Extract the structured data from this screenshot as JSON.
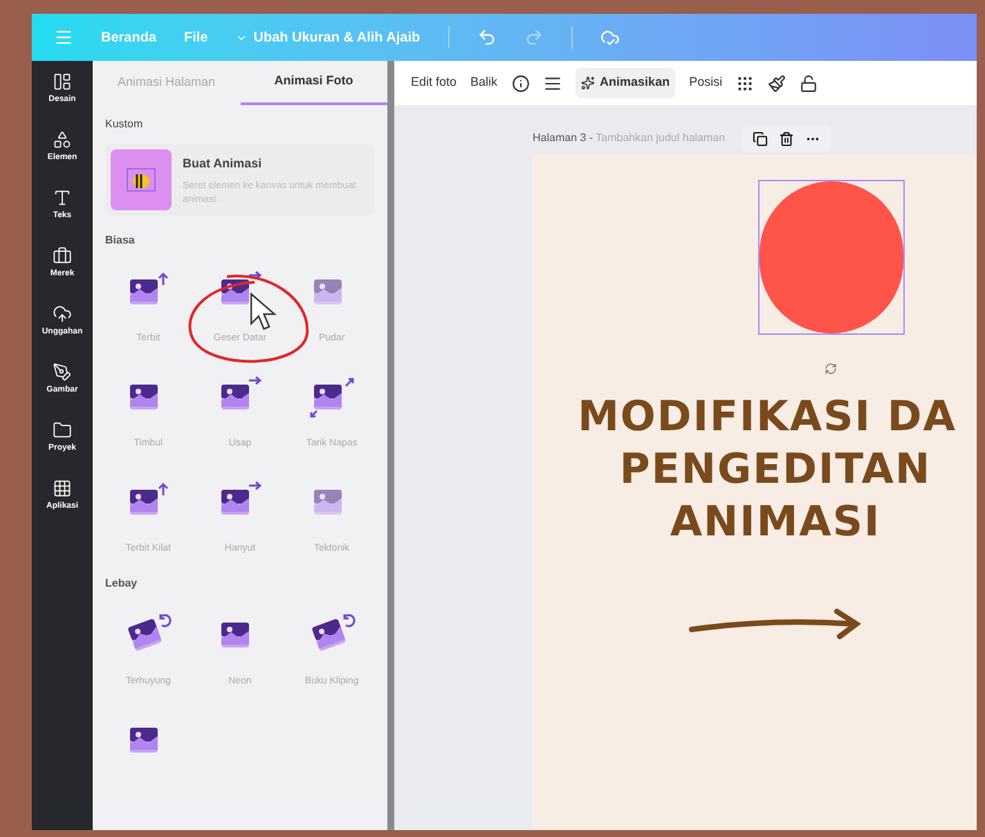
{
  "topbar": {
    "items": [
      {
        "label": "Beranda"
      },
      {
        "label": "File"
      },
      {
        "label": "Ubah Ukuran & Alih Ajaib"
      }
    ]
  },
  "rail": [
    {
      "label": "Desain",
      "kind": "layout"
    },
    {
      "label": "Elemen",
      "kind": "shapes"
    },
    {
      "label": "Teks",
      "kind": "text"
    },
    {
      "label": "Merek",
      "kind": "brand"
    },
    {
      "label": "Unggahan",
      "kind": "upload"
    },
    {
      "label": "Gambar",
      "kind": "draw"
    },
    {
      "label": "Proyek",
      "kind": "folder"
    },
    {
      "label": "Aplikasi",
      "kind": "apps"
    }
  ],
  "panel_tabs": [
    {
      "label": "Animasi Halaman",
      "selected": false
    },
    {
      "label": "Animasi Foto",
      "selected": true
    }
  ],
  "custom": {
    "heading": "Kustom",
    "title": "Buat Animasi",
    "description": "Seret elemen ke kanvas untuk membuat animasi."
  },
  "sections": [
    {
      "heading": "Biasa",
      "items": [
        {
          "label": "Terbit",
          "kind": "up"
        },
        {
          "label": "Geser Datar",
          "kind": "right"
        },
        {
          "label": "Pudar",
          "kind": "fade"
        },
        {
          "label": "Timbul",
          "kind": "plain"
        },
        {
          "label": "Usap",
          "kind": "right"
        },
        {
          "label": "Tarik Napas",
          "kind": "diag"
        },
        {
          "label": "Terbit Kilat",
          "kind": "up"
        },
        {
          "label": "Hanyut",
          "kind": "right"
        },
        {
          "label": "Tektonik",
          "kind": "fade"
        }
      ]
    },
    {
      "heading": "Lebay",
      "items": [
        {
          "label": "Terhuyung",
          "kind": "tilt"
        },
        {
          "label": "Neon",
          "kind": "plain"
        },
        {
          "label": "Buku Kliping",
          "kind": "tilt"
        },
        {
          "kind": "plain"
        }
      ]
    }
  ],
  "toolbar": {
    "items": [
      {
        "label": "Edit foto"
      },
      {
        "label": "Balik"
      }
    ],
    "animate": "Animasikan",
    "position": "Posisi"
  },
  "page": {
    "label": "Halaman 3 -",
    "placeholder": "Tambahkan judul halaman",
    "headline": [
      "MODIFIKASI DA",
      "PENGEDITAN",
      "ANIMASI"
    ]
  }
}
